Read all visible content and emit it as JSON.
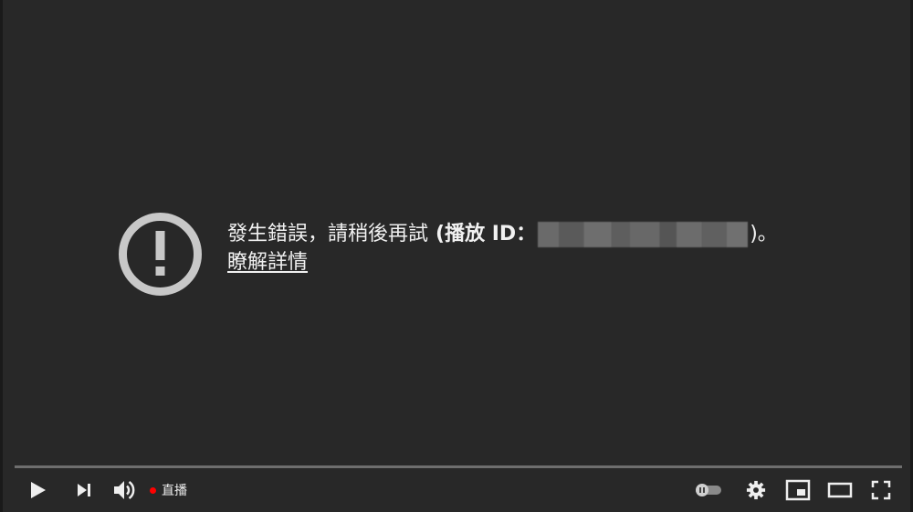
{
  "error": {
    "message": "發生錯誤，請稍後再試",
    "id_label": "(播放 ID：",
    "id_close": ")。",
    "learn_more": "瞭解詳情",
    "icon": "alert-circle-icon"
  },
  "controls": {
    "play_icon": "play-icon",
    "next_icon": "skip-next-icon",
    "volume_icon": "volume-icon",
    "live_label": "直播",
    "autoplay_icon": "autoplay-toggle-icon",
    "settings_icon": "gear-icon",
    "miniplayer_icon": "miniplayer-icon",
    "theater_icon": "theater-mode-icon",
    "fullscreen_icon": "fullscreen-icon"
  },
  "colors": {
    "background": "#282828",
    "text": "#f1f1f1",
    "live_dot": "#ff0000",
    "icon_gray": "#c8c8c8"
  }
}
